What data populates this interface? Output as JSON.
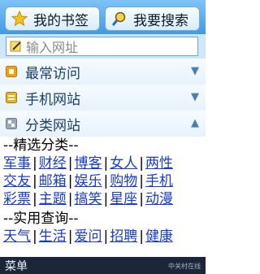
{
  "top": {
    "bookmarks_label": "我的书签",
    "search_label": "我要搜索"
  },
  "url": {
    "placeholder": "输入网址"
  },
  "sections": [
    {
      "label": "最常访问"
    },
    {
      "label": "手机网站"
    },
    {
      "label": "分类网站"
    }
  ],
  "categories": {
    "featured_heading": "--精选分类--",
    "row1": [
      "军事",
      "财经",
      "博客",
      "女人",
      "两性"
    ],
    "row2": [
      "交友",
      "邮箱",
      "娱乐",
      "购物",
      "手机"
    ],
    "row3": [
      "彩票",
      "主题",
      "搞笑",
      "星座",
      "动漫"
    ],
    "practical_heading": "--实用查询--",
    "row4": [
      "天气",
      "生活",
      "爱问",
      "招聘",
      "健康"
    ]
  },
  "bottom": {
    "menu_label": "菜单",
    "watermark": "中关村在线"
  },
  "colors": {
    "topbar": "#3f9ae6",
    "link": "#1b3cc5",
    "bottombar": "#1b2738"
  }
}
